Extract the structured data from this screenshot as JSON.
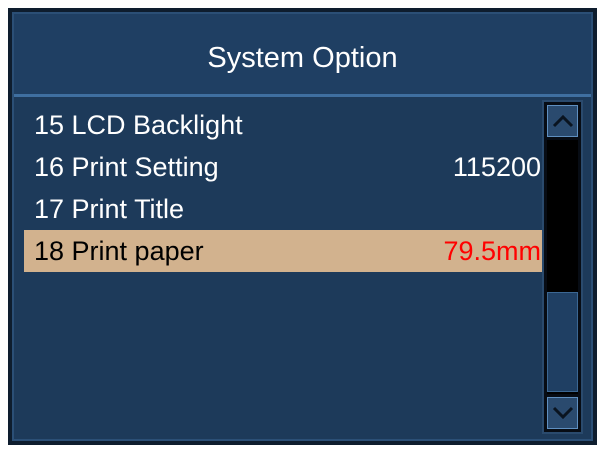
{
  "window": {
    "title": "System Option"
  },
  "items": [
    {
      "number": "15",
      "label": "15 LCD Backlight",
      "value": ""
    },
    {
      "number": "16",
      "label": "16 Print Setting",
      "value": "115200"
    },
    {
      "number": "17",
      "label": "17 Print Title",
      "value": ""
    },
    {
      "number": "18",
      "label": "18 Print paper",
      "value": "79.5mm",
      "selected": true
    }
  ],
  "icons": {
    "scroll_up": "chevron-up-icon",
    "scroll_down": "chevron-down-icon"
  },
  "colors": {
    "panel": "#1d3a5a",
    "selected_row": "#d2b28e",
    "selected_value": "#ff0000",
    "text": "#ffffff"
  }
}
